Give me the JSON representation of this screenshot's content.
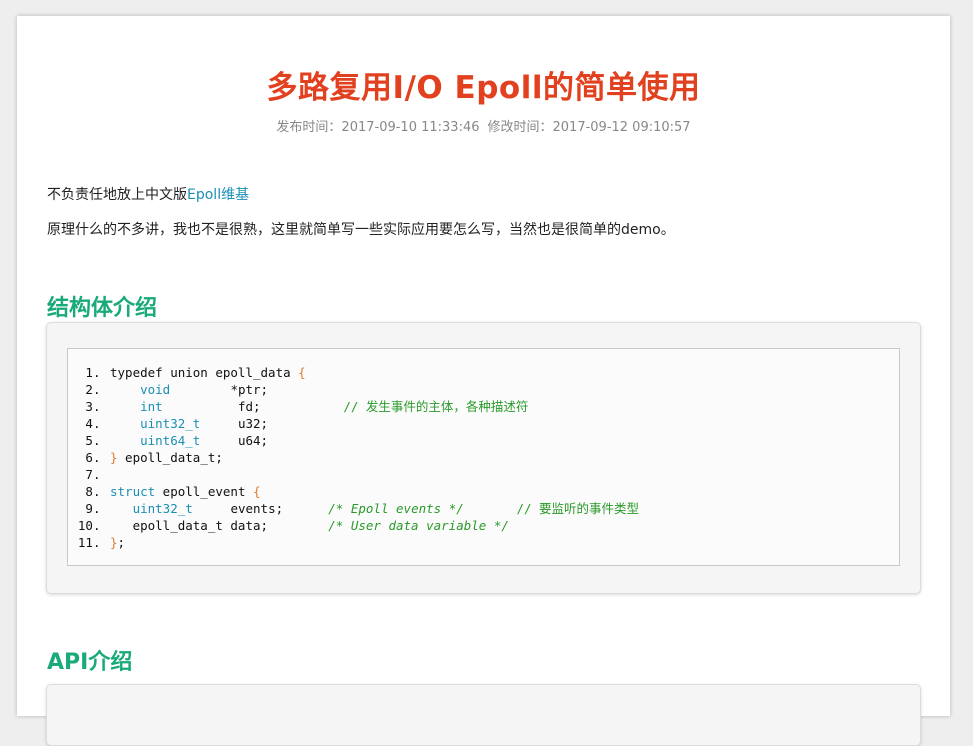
{
  "article": {
    "title": "多路复用I/O Epoll的简单使用",
    "published": "发布时间：2017-09-10 11:33:46",
    "modified": "修改时间：2017-09-12 09:10:57",
    "intro_prefix": "不负责任地放上中文版",
    "intro_link": "Epoll维基",
    "intro2": "原理什么的不多讲，我也不是很熟，这里就简单写一些实际应用要怎么写，当然也是很简单的demo。",
    "section1": "结构体介绍",
    "section2": "API介绍"
  },
  "code": {
    "lines": [
      {
        "pre": "typedef union epoll_data ",
        "br": "{"
      },
      {
        "ind": "    ",
        "kw": "void",
        "pad": "        ",
        "txt": "*ptr;"
      },
      {
        "ind": "    ",
        "kw": "int",
        "pad": "          ",
        "txt": "fd;",
        "gap": "           ",
        "cm": "// 发生事件的主体，各种描述符"
      },
      {
        "ind": "    ",
        "kw": "uint32_t",
        "pad": "     ",
        "txt": "u32;"
      },
      {
        "ind": "    ",
        "kw": "uint64_t",
        "pad": "     ",
        "txt": "u64;"
      },
      {
        "br": "}",
        "post": " epoll_data_t;"
      },
      {},
      {
        "kw": "struct",
        "post": " epoll_event ",
        "br2": "{"
      },
      {
        "ind": "   ",
        "kw": "uint32_t",
        "pad": "     ",
        "txt": "events;",
        "gap": "      ",
        "cmi": "/* Epoll events */",
        "gap2": "       ",
        "cm": "// 要监听的事件类型"
      },
      {
        "ind": "   ",
        "txt": "epoll_data_t data;",
        "gap": "        ",
        "cmi": "/* User data variable */"
      },
      {
        "br": "}",
        "post": ";"
      }
    ]
  }
}
